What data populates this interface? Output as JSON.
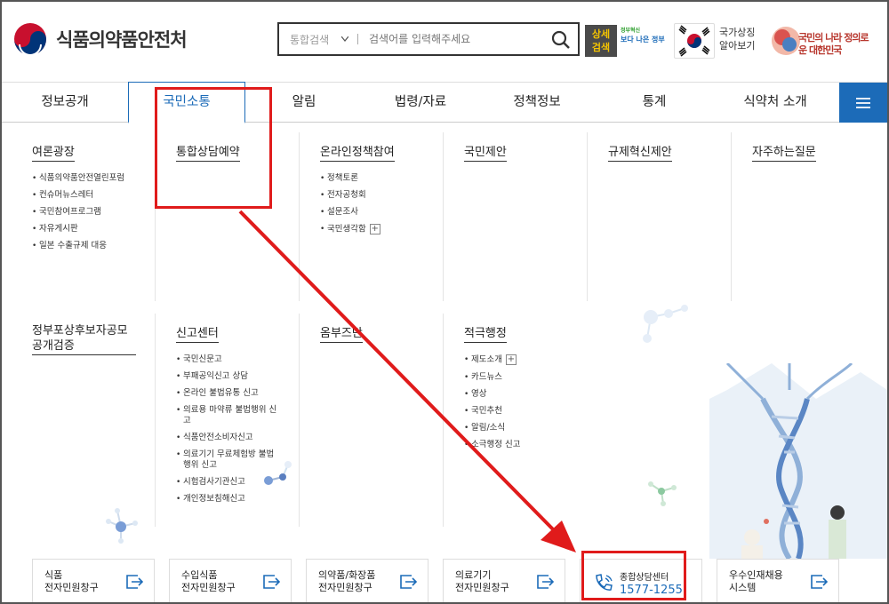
{
  "header": {
    "site_title": "식품의약품안전처",
    "search": {
      "scope": "통합검색",
      "placeholder": "검색어를 입력해주세요"
    },
    "detail_search": "상세 검색",
    "gov_slogan_small": "정부혁신",
    "gov_slogan": "보다 나은 정부",
    "national_symbol": "국가상징 알아보기",
    "slogan": "국민의 나라 정의로운 대한민국",
    "accent_color": "#1c6bb8"
  },
  "nav": {
    "items": [
      "정보공개",
      "국민소통",
      "알림",
      "법령/자료",
      "정책정보",
      "통계",
      "식약처 소개"
    ],
    "active": "국민소통"
  },
  "mega": {
    "row1": [
      {
        "title": "여론광장",
        "items": [
          "식품의약품안전열린포럼",
          "컨슈머뉴스레터",
          "국민참여프로그램",
          "자유게시판",
          "일본 수출규제 대응"
        ]
      },
      {
        "title": "통합상담예약",
        "items": []
      },
      {
        "title": "온라인정책참여",
        "items": [
          "정책토론",
          "전자공청회",
          "설문조사",
          "국민생각함"
        ]
      },
      {
        "title": "국민제안",
        "items": []
      },
      {
        "title": "규제혁신제안",
        "items": []
      },
      {
        "title": "자주하는질문",
        "items": []
      }
    ],
    "row2": [
      {
        "title": "정부포상후보자공모공개검증",
        "items": []
      },
      {
        "title": "신고센터",
        "items": [
          "국민신문고",
          "부패공익신고 상담",
          "온라인 불법유통 신고",
          "의료용 마약류 불법행위 신고",
          "식품안전소비자신고",
          "의료기기 무료체험방 불법 행위 신고",
          "시험검사기관신고",
          "개인정보침해신고"
        ]
      },
      {
        "title": "옴부즈만",
        "items": []
      },
      {
        "title": "적극행정",
        "items": [
          "제도소개",
          "카드뉴스",
          "영상",
          "국민추천",
          "알림/소식",
          "소극행정 신고"
        ]
      }
    ]
  },
  "cards": [
    {
      "line1": "식품",
      "line2": "전자민원창구"
    },
    {
      "line1": "수입식품",
      "line2": "전자민원창구"
    },
    {
      "line1": "의약품/화장품",
      "line2": "전자민원창구"
    },
    {
      "line1": "의료기기",
      "line2": "전자민원창구"
    },
    {
      "line1": "종합상담센터",
      "line2": "1577-1255"
    },
    {
      "line1": "우수인재채용",
      "line2": "시스템"
    }
  ]
}
